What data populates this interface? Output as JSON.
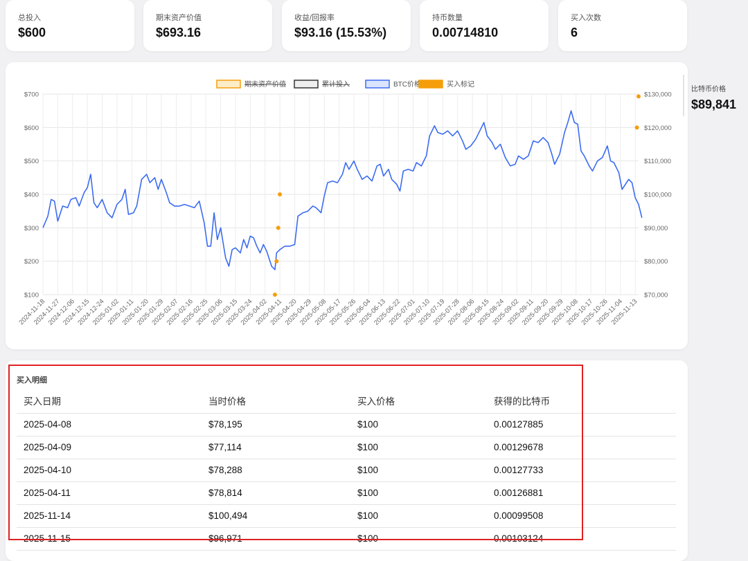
{
  "stats": [
    {
      "label": "总投入",
      "value": "$600"
    },
    {
      "label": "期末资产价值",
      "value": "$693.16"
    },
    {
      "label": "收益/回报率",
      "value": "$93.16 (15.53%)"
    },
    {
      "label": "持币数量",
      "value": "0.00714810"
    },
    {
      "label": "买入次数",
      "value": "6"
    }
  ],
  "side_panel": {
    "label": "比特币价格",
    "value": "$89,841"
  },
  "chart_data": {
    "type": "line",
    "title": "",
    "legend": {
      "placement": "top-center",
      "items": [
        {
          "label": "期末资产价值",
          "color": "#f59e0b",
          "hidden": true
        },
        {
          "label": "累计投入",
          "color": "#333333",
          "hidden": true
        },
        {
          "label": "BTC价格",
          "color": "#3b6cf0",
          "hidden": false
        },
        {
          "label": "买入标记",
          "color": "#f59e0b",
          "hidden": false
        }
      ]
    },
    "y_left": {
      "min": 100,
      "max": 700,
      "ticks": [
        "$700",
        "$600",
        "$500",
        "$400",
        "$300",
        "$200",
        "$100"
      ]
    },
    "y_right": {
      "min": 70000,
      "max": 130000,
      "ticks": [
        "$130,000",
        "$120,000",
        "$110,000",
        "$100,000",
        "$90,000",
        "$80,000",
        "$70,000"
      ]
    },
    "x_ticks": [
      "2024-11-18",
      "2024-11-27",
      "2024-12-06",
      "2024-12-15",
      "2024-12-24",
      "2025-01-02",
      "2025-01-11",
      "2025-01-20",
      "2025-01-29",
      "2025-02-07",
      "2025-02-16",
      "2025-02-25",
      "2025-03-06",
      "2025-03-15",
      "2025-03-24",
      "2025-04-02",
      "2025-04-11",
      "2025-04-20",
      "2025-04-29",
      "2025-05-08",
      "2025-05-17",
      "2025-05-26",
      "2025-06-04",
      "2025-06-13",
      "2025-06-22",
      "2025-07-01",
      "2025-07-10",
      "2025-07-19",
      "2025-07-28",
      "2025-08-06",
      "2025-08-15",
      "2025-08-24",
      "2025-09-02",
      "2025-09-11",
      "2025-09-20",
      "2025-09-29",
      "2025-10-08",
      "2025-10-17",
      "2025-10-26",
      "2025-11-04",
      "2025-11-13"
    ],
    "series": [
      {
        "name": "BTC价格",
        "color": "#3b6cf0",
        "axis": "right",
        "points": [
          [
            "2024-11-18",
            90000
          ],
          [
            "2024-11-21",
            93500
          ],
          [
            "2024-11-23",
            98500
          ],
          [
            "2024-11-25",
            98000
          ],
          [
            "2024-11-27",
            92000
          ],
          [
            "2024-11-30",
            96500
          ],
          [
            "2024-12-03",
            96000
          ],
          [
            "2024-12-05",
            98500
          ],
          [
            "2024-12-08",
            99000
          ],
          [
            "2024-12-10",
            96500
          ],
          [
            "2024-12-13",
            100500
          ],
          [
            "2024-12-15",
            102000
          ],
          [
            "2024-12-17",
            106000
          ],
          [
            "2024-12-19",
            97500
          ],
          [
            "2024-12-21",
            96000
          ],
          [
            "2024-12-24",
            98500
          ],
          [
            "2024-12-27",
            94500
          ],
          [
            "2024-12-30",
            93000
          ],
          [
            "2025-01-02",
            97000
          ],
          [
            "2025-01-05",
            98500
          ],
          [
            "2025-01-07",
            101500
          ],
          [
            "2025-01-09",
            94000
          ],
          [
            "2025-01-12",
            94500
          ],
          [
            "2025-01-14",
            96500
          ],
          [
            "2025-01-17",
            104500
          ],
          [
            "2025-01-20",
            106000
          ],
          [
            "2025-01-22",
            103500
          ],
          [
            "2025-01-25",
            105000
          ],
          [
            "2025-01-27",
            101500
          ],
          [
            "2025-01-29",
            104500
          ],
          [
            "2025-02-01",
            100500
          ],
          [
            "2025-02-03",
            97500
          ],
          [
            "2025-02-06",
            96500
          ],
          [
            "2025-02-09",
            96500
          ],
          [
            "2025-02-12",
            97000
          ],
          [
            "2025-02-15",
            96500
          ],
          [
            "2025-02-18",
            96000
          ],
          [
            "2025-02-21",
            98000
          ],
          [
            "2025-02-24",
            91500
          ],
          [
            "2025-02-26",
            84500
          ],
          [
            "2025-02-28",
            84500
          ],
          [
            "2025-03-02",
            94500
          ],
          [
            "2025-03-04",
            86500
          ],
          [
            "2025-03-06",
            90000
          ],
          [
            "2025-03-09",
            81000
          ],
          [
            "2025-03-11",
            78500
          ],
          [
            "2025-03-13",
            83500
          ],
          [
            "2025-03-15",
            84000
          ],
          [
            "2025-03-18",
            82500
          ],
          [
            "2025-03-20",
            86500
          ],
          [
            "2025-03-22",
            84000
          ],
          [
            "2025-03-24",
            87500
          ],
          [
            "2025-03-26",
            87000
          ],
          [
            "2025-03-28",
            84500
          ],
          [
            "2025-03-30",
            82500
          ],
          [
            "2025-04-01",
            85000
          ],
          [
            "2025-04-03",
            83000
          ],
          [
            "2025-04-06",
            78500
          ],
          [
            "2025-04-08",
            77500
          ],
          [
            "2025-04-09",
            82500
          ],
          [
            "2025-04-11",
            83500
          ],
          [
            "2025-04-14",
            84500
          ],
          [
            "2025-04-17",
            84500
          ],
          [
            "2025-04-20",
            85000
          ],
          [
            "2025-04-22",
            93500
          ],
          [
            "2025-04-25",
            94500
          ],
          [
            "2025-04-28",
            95000
          ],
          [
            "2025-05-01",
            96500
          ],
          [
            "2025-05-03",
            96000
          ],
          [
            "2025-05-06",
            94500
          ],
          [
            "2025-05-08",
            99500
          ],
          [
            "2025-05-10",
            103500
          ],
          [
            "2025-05-13",
            104000
          ],
          [
            "2025-05-16",
            103500
          ],
          [
            "2025-05-19",
            106000
          ],
          [
            "2025-05-21",
            109500
          ],
          [
            "2025-05-23",
            107500
          ],
          [
            "2025-05-26",
            110000
          ],
          [
            "2025-05-28",
            107500
          ],
          [
            "2025-05-31",
            104500
          ],
          [
            "2025-06-03",
            105500
          ],
          [
            "2025-06-06",
            104000
          ],
          [
            "2025-06-09",
            108500
          ],
          [
            "2025-06-11",
            109000
          ],
          [
            "2025-06-13",
            105500
          ],
          [
            "2025-06-16",
            107500
          ],
          [
            "2025-06-18",
            104500
          ],
          [
            "2025-06-21",
            103000
          ],
          [
            "2025-06-23",
            101000
          ],
          [
            "2025-06-25",
            107000
          ],
          [
            "2025-06-28",
            107500
          ],
          [
            "2025-07-01",
            107000
          ],
          [
            "2025-07-03",
            109500
          ],
          [
            "2025-07-06",
            108500
          ],
          [
            "2025-07-09",
            111500
          ],
          [
            "2025-07-11",
            117500
          ],
          [
            "2025-07-14",
            120500
          ],
          [
            "2025-07-16",
            118500
          ],
          [
            "2025-07-19",
            118000
          ],
          [
            "2025-07-22",
            119000
          ],
          [
            "2025-07-25",
            117500
          ],
          [
            "2025-07-28",
            119000
          ],
          [
            "2025-07-31",
            116000
          ],
          [
            "2025-08-02",
            113500
          ],
          [
            "2025-08-05",
            114500
          ],
          [
            "2025-08-08",
            116500
          ],
          [
            "2025-08-11",
            119500
          ],
          [
            "2025-08-13",
            121500
          ],
          [
            "2025-08-15",
            117500
          ],
          [
            "2025-08-18",
            115500
          ],
          [
            "2025-08-20",
            113500
          ],
          [
            "2025-08-23",
            115000
          ],
          [
            "2025-08-26",
            111000
          ],
          [
            "2025-08-29",
            108500
          ],
          [
            "2025-09-01",
            109000
          ],
          [
            "2025-09-03",
            111500
          ],
          [
            "2025-09-06",
            110500
          ],
          [
            "2025-09-09",
            111500
          ],
          [
            "2025-09-12",
            116000
          ],
          [
            "2025-09-15",
            115500
          ],
          [
            "2025-09-18",
            117000
          ],
          [
            "2025-09-21",
            115500
          ],
          [
            "2025-09-23",
            112500
          ],
          [
            "2025-09-25",
            109000
          ],
          [
            "2025-09-28",
            112000
          ],
          [
            "2025-10-01",
            118500
          ],
          [
            "2025-10-03",
            121500
          ],
          [
            "2025-10-05",
            125000
          ],
          [
            "2025-10-07",
            121500
          ],
          [
            "2025-10-09",
            121000
          ],
          [
            "2025-10-11",
            113000
          ],
          [
            "2025-10-13",
            111500
          ],
          [
            "2025-10-16",
            108500
          ],
          [
            "2025-10-18",
            107000
          ],
          [
            "2025-10-21",
            110000
          ],
          [
            "2025-10-24",
            111000
          ],
          [
            "2025-10-27",
            114500
          ],
          [
            "2025-10-29",
            110000
          ],
          [
            "2025-10-31",
            109500
          ],
          [
            "2025-11-03",
            106500
          ],
          [
            "2025-11-05",
            101500
          ],
          [
            "2025-11-07",
            103000
          ],
          [
            "2025-11-09",
            104500
          ],
          [
            "2025-11-11",
            103500
          ],
          [
            "2025-11-13",
            99000
          ],
          [
            "2025-11-15",
            97000
          ],
          [
            "2025-11-17",
            93000
          ]
        ]
      },
      {
        "name": "买入标记",
        "color": "#f59e0b",
        "axis": "left",
        "points": [
          [
            "2025-04-08",
            100
          ],
          [
            "2025-04-09",
            200
          ],
          [
            "2025-04-10",
            300
          ],
          [
            "2025-04-11",
            400
          ],
          [
            "2025-11-14",
            600
          ],
          [
            "2025-11-15",
            693
          ]
        ]
      }
    ]
  },
  "table": {
    "title": "买入明细",
    "headers": [
      "买入日期",
      "当时价格",
      "买入价格",
      "获得的比特币"
    ],
    "rows": [
      [
        "2025-04-08",
        "$78,195",
        "$100",
        "0.00127885"
      ],
      [
        "2025-04-09",
        "$77,114",
        "$100",
        "0.00129678"
      ],
      [
        "2025-04-10",
        "$78,288",
        "$100",
        "0.00127733"
      ],
      [
        "2025-04-11",
        "$78,814",
        "$100",
        "0.00126881"
      ],
      [
        "2025-11-14",
        "$100,494",
        "$100",
        "0.00099508"
      ],
      [
        "2025-11-15",
        "$96,971",
        "$100",
        "0.00103124"
      ]
    ]
  },
  "colors": {
    "accent": "#3b6cf0",
    "marker": "#f59e0b",
    "highlight": "#e02020"
  }
}
